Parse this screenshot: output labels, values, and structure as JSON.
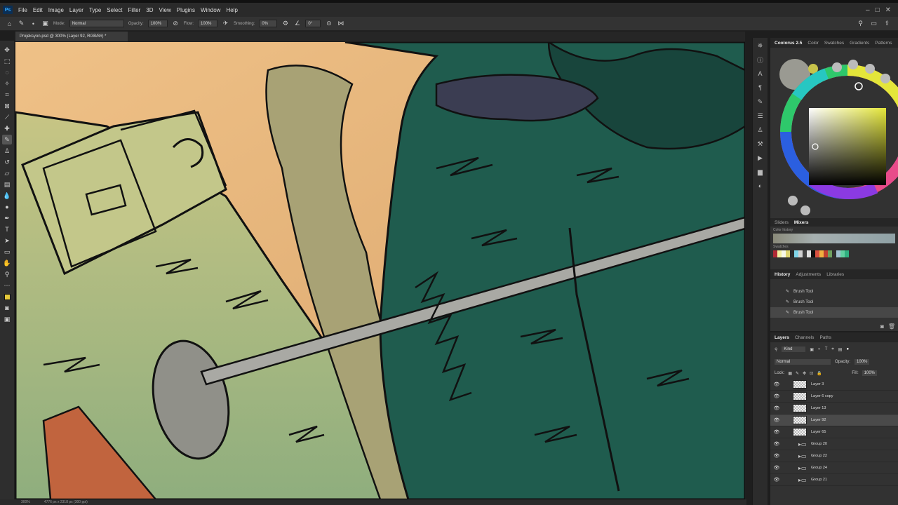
{
  "app": {
    "logo": "Ps"
  },
  "menu": [
    "File",
    "Edit",
    "Image",
    "Layer",
    "Type",
    "Select",
    "Filter",
    "3D",
    "View",
    "Plugins",
    "Window",
    "Help"
  ],
  "options": {
    "mode_label": "Mode:",
    "mode_value": "Normal",
    "opacity_label": "Opacity:",
    "opacity_value": "100%",
    "flow_label": "Flow:",
    "flow_value": "100%",
    "smoothing_label": "Smoothing:",
    "smoothing_value": "0%",
    "angle_value": "0°"
  },
  "document": {
    "tab_title": "Projeksyon.psd @ 300% (Layer 92, RGB/8#) *"
  },
  "status": {
    "zoom": "300%",
    "doc_info": "4776 px x 2318 px (300 ppi)"
  },
  "color_panel": {
    "tabs": [
      "Coolorus 2.5",
      "Color",
      "Swatches",
      "Gradients",
      "Patterns"
    ],
    "active_tab": "Coolorus 2.5",
    "sub_tabs": [
      "Sliders",
      "Mixers"
    ],
    "history_label": "Color history",
    "swatches_label": "Swatches"
  },
  "history_panel": {
    "tabs": [
      "History",
      "Adjustments",
      "Libraries"
    ],
    "items": [
      "Brush Tool",
      "Brush Tool",
      "Brush Tool"
    ]
  },
  "layers_panel": {
    "tabs": [
      "Layers",
      "Channels",
      "Paths"
    ],
    "kind": "Kind",
    "blend": "Normal",
    "opacity_label": "Opacity:",
    "opacity_value": "100%",
    "lock_label": "Lock:",
    "fill_label": "Fill:",
    "fill_value": "100%",
    "layers": [
      {
        "name": "Layer 3",
        "type": "layer"
      },
      {
        "name": "Layer 6 copy",
        "type": "layer"
      },
      {
        "name": "Layer 13",
        "type": "layer"
      },
      {
        "name": "Layer 92",
        "type": "layer",
        "selected": true
      },
      {
        "name": "Layer 65",
        "type": "layer"
      },
      {
        "name": "Group 20",
        "type": "group"
      },
      {
        "name": "Group 22",
        "type": "group"
      },
      {
        "name": "Group 24",
        "type": "group"
      },
      {
        "name": "Group 21",
        "type": "group"
      }
    ]
  },
  "colors": {
    "accent": "#31a8ff",
    "foreground": "#e4c83a",
    "canvas_sky": "#e7b77c",
    "canvas_grass": "#b9bd7c",
    "canvas_forest": "#1f5c4e"
  }
}
